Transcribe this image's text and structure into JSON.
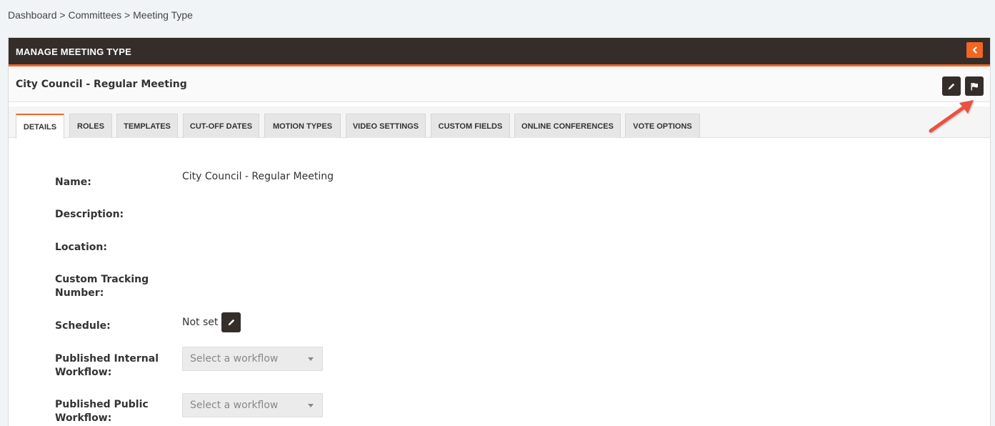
{
  "breadcrumb": {
    "items": [
      "Dashboard",
      "Committees",
      "Meeting Type"
    ],
    "separator": ">"
  },
  "panel": {
    "title": "MANAGE MEETING TYPE",
    "collapse_icon": "chevron-left-icon"
  },
  "record": {
    "title": "City Council - Regular Meeting",
    "edit_icon": "pencil-icon",
    "flag_icon": "flag-icon"
  },
  "tabs": [
    {
      "label": "DETAILS",
      "active": true
    },
    {
      "label": "ROLES"
    },
    {
      "label": "TEMPLATES"
    },
    {
      "label": "CUT-OFF DATES"
    },
    {
      "label": "MOTION TYPES"
    },
    {
      "label": "VIDEO SETTINGS"
    },
    {
      "label": "CUSTOM FIELDS"
    },
    {
      "label": "ONLINE CONFERENCES"
    },
    {
      "label": "VOTE OPTIONS"
    }
  ],
  "details": {
    "name_label": "Name:",
    "name_value": "City Council - Regular Meeting",
    "description_label": "Description:",
    "location_label": "Location:",
    "tracking_label_line1": "Custom Tracking",
    "tracking_label_line2": "Number:",
    "schedule_label": "Schedule:",
    "schedule_value": "Not set",
    "internal_workflow_label_line1": "Published Internal",
    "internal_workflow_label_line2": "Workflow:",
    "internal_workflow_placeholder": "Select a workflow",
    "public_workflow_label_line1": "Published Public",
    "public_workflow_label_line2": "Workflow:",
    "public_workflow_placeholder": "Select a workflow"
  },
  "colors": {
    "header_bg": "#352d2a",
    "accent": "#f26522",
    "annotation_arrow": "#e8533f"
  }
}
